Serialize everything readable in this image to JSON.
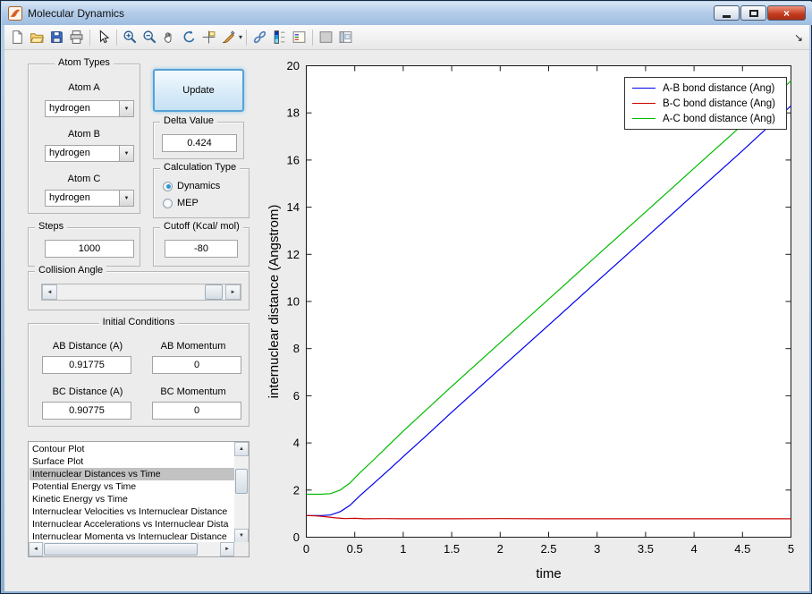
{
  "window": {
    "title": "Molecular Dynamics"
  },
  "icons": {
    "dropdown_arrow": "▼",
    "scroll_up": "▲",
    "scroll_down": "▼",
    "scroll_left": "◄",
    "scroll_right": "►",
    "slider_left": "◄",
    "slider_right": "►",
    "brush_dropdown": "▾",
    "dock_arrow": "↘",
    "close_glyph": "×"
  },
  "toolbar": {
    "icon_names": [
      "new-document",
      "open-folder",
      "save",
      "print",
      "edit-plot-arrow",
      "zoom-in",
      "zoom-out",
      "pan-hand",
      "rotate-3d",
      "data-cursor",
      "brush-data",
      "link-plot",
      "insert-colorbar",
      "insert-legend",
      "hide-plot-tools",
      "show-plot-tools",
      "dock-figure"
    ]
  },
  "controls": {
    "atom_types": {
      "title": "Atom Types",
      "atom_a_label": "Atom A",
      "atom_a_value": "hydrogen",
      "atom_b_label": "Atom B",
      "atom_b_value": "hydrogen",
      "atom_c_label": "Atom C",
      "atom_c_value": "hydrogen"
    },
    "update_button": "Update",
    "delta": {
      "title": "Delta Value",
      "value": "0.424"
    },
    "calc_type": {
      "title": "Calculation Type",
      "options": [
        {
          "label": "Dynamics",
          "selected": true
        },
        {
          "label": "MEP",
          "selected": false
        }
      ]
    },
    "steps": {
      "title": "Steps",
      "value": "1000"
    },
    "cutoff": {
      "title": "Cutoff (Kcal/ mol)",
      "value": "-80"
    },
    "collision": {
      "title": "Collision Angle"
    },
    "initial": {
      "title": "Initial Conditions",
      "ab_distance_label": "AB Distance (A)",
      "ab_distance_value": "0.91775",
      "ab_momentum_label": "AB Momentum",
      "ab_momentum_value": "0",
      "bc_distance_label": "BC Distance (A)",
      "bc_distance_value": "0.90775",
      "bc_momentum_label": "BC Momentum",
      "bc_momentum_value": "0"
    },
    "plot_list": {
      "selected_index": 2,
      "items": [
        "Contour Plot",
        "Surface Plot",
        "Internuclear Distances vs Time",
        "Potential Energy vs Time",
        "Kinetic Energy vs Time",
        "Internuclear Velocities vs Internuclear Distance",
        "Internuclear Accelerations vs Internuclear Dista",
        "Internuclear Momenta vs Internuclear Distance"
      ]
    }
  },
  "chart_data": {
    "type": "line",
    "title": "",
    "xlabel": "time",
    "ylabel": "internuclear distance (Angstrom)",
    "xlim": [
      0,
      5
    ],
    "ylim": [
      0,
      20
    ],
    "xtick_values": [
      0,
      0.5,
      1,
      1.5,
      2,
      2.5,
      3,
      3.5,
      4,
      4.5,
      5
    ],
    "xtick_labels": [
      "0",
      "0.5",
      "1",
      "1.5",
      "2",
      "2.5",
      "3",
      "3.5",
      "4",
      "4.5",
      "5"
    ],
    "ytick_values": [
      0,
      2,
      4,
      6,
      8,
      10,
      12,
      14,
      16,
      18,
      20
    ],
    "ytick_labels": [
      "0",
      "2",
      "4",
      "6",
      "8",
      "10",
      "12",
      "14",
      "16",
      "18",
      "20"
    ],
    "grid": false,
    "legend_position": "top-right",
    "series": [
      {
        "label": "A-B bond distance (Ang)",
        "color": "#0000ee",
        "points": [
          [
            0,
            0.918
          ],
          [
            0.15,
            0.918
          ],
          [
            0.25,
            0.94
          ],
          [
            0.35,
            1.08
          ],
          [
            0.45,
            1.35
          ],
          [
            0.55,
            1.75
          ],
          [
            0.7,
            2.3
          ],
          [
            0.85,
            2.85
          ],
          [
            1,
            3.42
          ],
          [
            1.25,
            4.35
          ],
          [
            1.5,
            5.3
          ],
          [
            2,
            7.15
          ],
          [
            2.5,
            9.0
          ],
          [
            3,
            10.85
          ],
          [
            3.5,
            12.7
          ],
          [
            4,
            14.55
          ],
          [
            4.5,
            16.4
          ],
          [
            5,
            18.3
          ]
        ]
      },
      {
        "label": "B-C bond distance (Ang)",
        "color": "#cc0000",
        "points": [
          [
            0,
            0.918
          ],
          [
            0.1,
            0.905
          ],
          [
            0.2,
            0.87
          ],
          [
            0.3,
            0.82
          ],
          [
            0.4,
            0.79
          ],
          [
            0.5,
            0.8
          ],
          [
            0.6,
            0.78
          ],
          [
            0.8,
            0.79
          ],
          [
            1,
            0.78
          ],
          [
            1.5,
            0.78
          ],
          [
            2,
            0.79
          ],
          [
            2.5,
            0.78
          ],
          [
            3,
            0.78
          ],
          [
            3.5,
            0.78
          ],
          [
            4,
            0.78
          ],
          [
            4.5,
            0.78
          ],
          [
            5,
            0.78
          ]
        ]
      },
      {
        "label": "A-C bond distance (Ang)",
        "color": "#00bb00",
        "points": [
          [
            0,
            1.82
          ],
          [
            0.15,
            1.82
          ],
          [
            0.25,
            1.85
          ],
          [
            0.35,
            2.0
          ],
          [
            0.45,
            2.3
          ],
          [
            0.55,
            2.72
          ],
          [
            0.7,
            3.3
          ],
          [
            0.85,
            3.9
          ],
          [
            1,
            4.5
          ],
          [
            1.25,
            5.45
          ],
          [
            1.5,
            6.4
          ],
          [
            2,
            8.25
          ],
          [
            2.5,
            10.1
          ],
          [
            3,
            11.95
          ],
          [
            3.5,
            13.8
          ],
          [
            4,
            15.65
          ],
          [
            4.5,
            17.5
          ],
          [
            5,
            19.35
          ]
        ]
      }
    ]
  }
}
